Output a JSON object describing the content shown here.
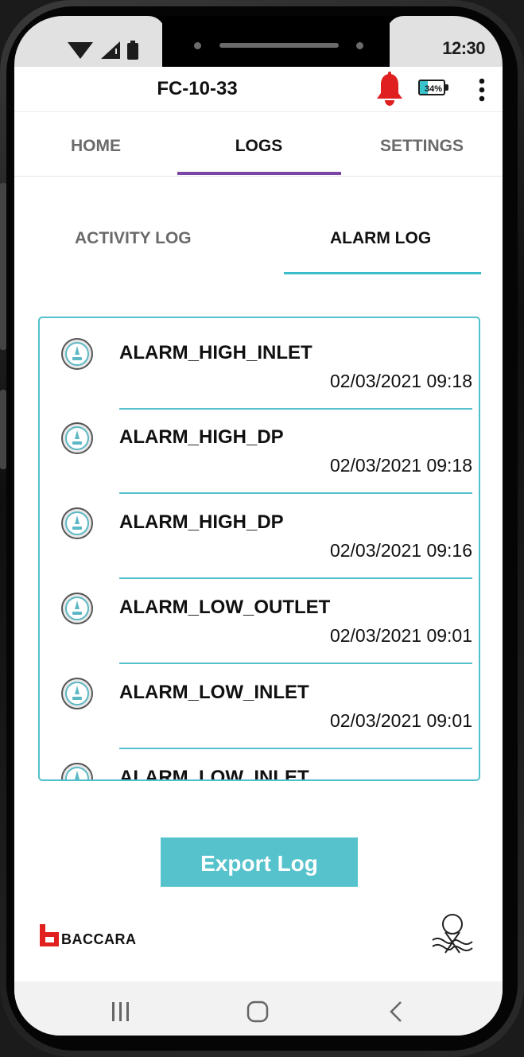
{
  "status_bar": {
    "time": "12:30"
  },
  "app_bar": {
    "title": "FC-10-33",
    "battery_percent": "34%",
    "battery_level": 0.34
  },
  "main_tabs": [
    {
      "label": "HOME",
      "active": false
    },
    {
      "label": "LOGS",
      "active": true
    },
    {
      "label": "SETTINGS",
      "active": false
    }
  ],
  "sub_tabs": [
    {
      "label": "ACTIVITY LOG",
      "active": false
    },
    {
      "label": "ALARM LOG",
      "active": true
    }
  ],
  "alarm_log": [
    {
      "name": "ALARM_HIGH_INLET",
      "time": "02/03/2021 09:18"
    },
    {
      "name": "ALARM_HIGH_DP",
      "time": "02/03/2021 09:18"
    },
    {
      "name": "ALARM_HIGH_DP",
      "time": "02/03/2021 09:16"
    },
    {
      "name": "ALARM_LOW_OUTLET",
      "time": "02/03/2021 09:01"
    },
    {
      "name": "ALARM_LOW_INLET",
      "time": "02/03/2021 09:01"
    },
    {
      "name": "ALARM_LOW_INLET",
      "time": ""
    }
  ],
  "export_button": {
    "label": "Export Log"
  },
  "brand": {
    "name": "BACCARA"
  },
  "colors": {
    "accent": "#56c2cb",
    "tab_indicator": "#7a45a5",
    "alarm_bell": "#e02020"
  },
  "icons": {
    "log_item": "gauge-icon",
    "bell": "bell-icon",
    "menu": "more-vert-icon",
    "nav_recents": "recents-icon",
    "nav_home": "home-icon",
    "nav_back": "back-icon"
  }
}
